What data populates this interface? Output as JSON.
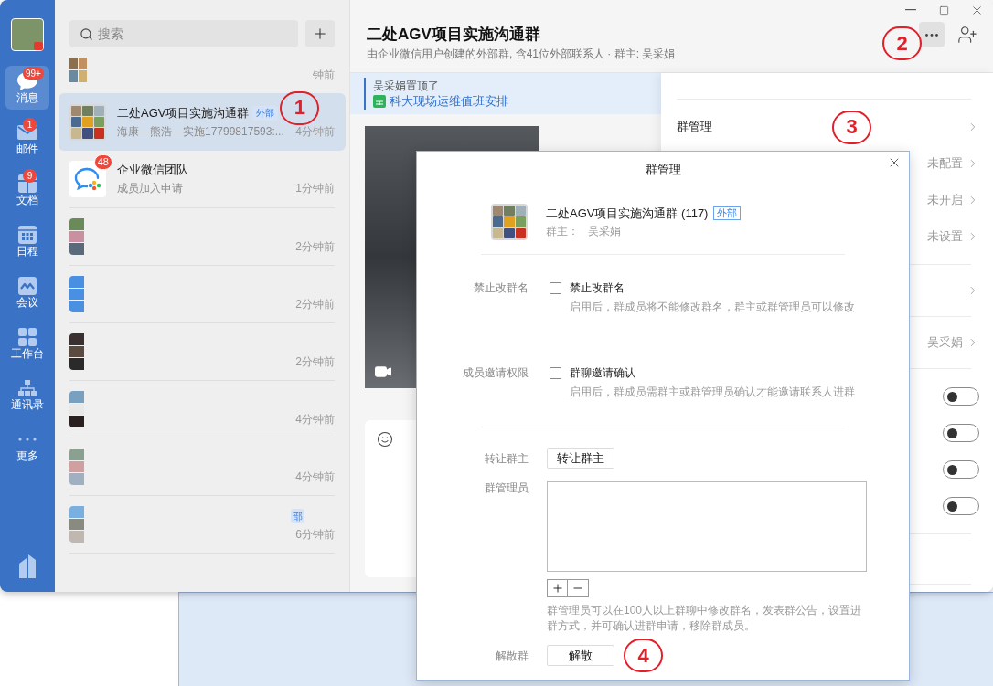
{
  "nav": {
    "items": [
      {
        "label": "消息",
        "badge": "99+",
        "selected": true
      },
      {
        "label": "邮件",
        "badge": "1",
        "selected": false
      },
      {
        "label": "文档",
        "badge": "9",
        "selected": false
      },
      {
        "label": "日程",
        "selected": false
      },
      {
        "label": "会议",
        "selected": false
      },
      {
        "label": "工作台",
        "selected": false
      },
      {
        "label": "通讯录",
        "selected": false
      },
      {
        "label": "更多",
        "selected": false
      }
    ]
  },
  "search": {
    "placeholder": "搜索"
  },
  "chat_list": {
    "items": [
      {
        "kind": "partial",
        "time": "钟前",
        "selected": false
      },
      {
        "kind": "group",
        "title": "二处AGV项目实施沟通群",
        "tag": "外部",
        "annotation": "1",
        "preview": "海康—熊浩—实施17799817593:...",
        "time": "4分钟前",
        "selected": true
      },
      {
        "kind": "app",
        "title": "企业微信团队",
        "badge": "48",
        "preview": "成员加入申请",
        "time": "1分钟前",
        "selected": false
      },
      {
        "kind": "masked",
        "time": "2分钟前",
        "selected": false
      },
      {
        "kind": "masked",
        "time": "2分钟前",
        "selected": false
      },
      {
        "kind": "masked",
        "time": "2分钟前",
        "selected": false
      },
      {
        "kind": "masked",
        "time": "4分钟前",
        "selected": false
      },
      {
        "kind": "masked",
        "time": "4分钟前",
        "selected": false
      },
      {
        "kind": "masked",
        "tag": "部",
        "time": "6分钟前",
        "selected": false
      }
    ]
  },
  "chat_header": {
    "title": "二处AGV项目实施沟通群",
    "subtitle": "由企业微信用户创建的外部群, 含41位外部联系人 · 群主: 吴采娟",
    "annotation": "2"
  },
  "pinned": {
    "text": "吴采娟置顶了",
    "doc": "科大现场运维值班安排"
  },
  "settings_panel": {
    "sections": [
      {
        "rows": [
          {
            "kind": "link",
            "label": "群管理",
            "annotation": "3"
          },
          {
            "kind": "value",
            "value": "未配置"
          },
          {
            "kind": "value",
            "value": "未开启"
          },
          {
            "kind": "value",
            "value": "未设置"
          }
        ]
      },
      {
        "rows": [
          {
            "kind": "link"
          }
        ]
      },
      {
        "rows": [
          {
            "kind": "value",
            "value": "吴采娟"
          }
        ]
      },
      {
        "rows": [
          {
            "kind": "toggle",
            "on": false
          },
          {
            "kind": "toggle",
            "on": false
          },
          {
            "kind": "toggle",
            "on": false
          },
          {
            "kind": "toggle",
            "on": false
          }
        ]
      }
    ]
  },
  "dialog": {
    "title": "群管理",
    "group": {
      "name": "二处AGV项目实施沟通群 (117)",
      "tag": "外部",
      "owner_label": "群主：",
      "owner": "吴采娟"
    },
    "options": [
      {
        "label": "禁止改群名",
        "checkbox": "禁止改群名",
        "checked": false,
        "help": "启用后，群成员将不能修改群名，群主或群管理员可以修改"
      },
      {
        "label": "成员邀请权限",
        "checkbox": "群聊邀请确认",
        "checked": false,
        "help": "启用后，群成员需群主或群管理员确认才能邀请联系人进群"
      }
    ],
    "transfer": {
      "label": "转让群主",
      "button": "转让群主"
    },
    "admins": {
      "label": "群管理员",
      "help": "群管理员可以在100人以上群聊中修改群名，发表群公告，设置进群方式，并可确认进群申请，移除群成员。"
    },
    "dissolve": {
      "label": "解散群",
      "button": "解散",
      "annotation": "4"
    }
  }
}
